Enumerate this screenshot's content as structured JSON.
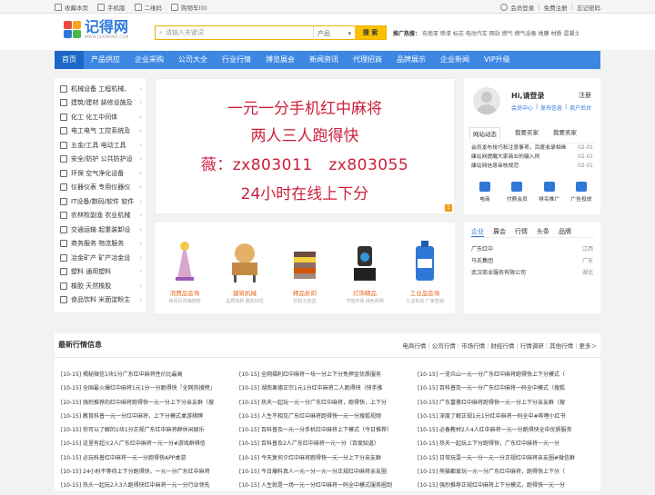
{
  "topbar": {
    "left": [
      "收藏本页",
      "手机版",
      "二维码",
      "购物车(0)"
    ],
    "right": [
      "会员登录",
      "免费注册",
      "忘记密码"
    ]
  },
  "logo": {
    "name": "记得网",
    "sub": "WWW.JIDEWANG.COM"
  },
  "search": {
    "placeholder": "请输入关键词",
    "category": "产品",
    "button": "搜 索"
  },
  "hot": {
    "label": "推广热搜：",
    "items": [
      "东南亚",
      "喷漆",
      "标志",
      "电动汽车",
      "网站",
      "燃气",
      "燃气设备",
      "地膜",
      "材质",
      "混凝土"
    ]
  },
  "nav": [
    "首页",
    "产品供应",
    "企业采购",
    "公司大全",
    "行业行情",
    "博览展会",
    "新闻资讯",
    "代理招商",
    "品牌展示",
    "企业新闻",
    "VIP升级"
  ],
  "categories": [
    "机械设备 工程机械、",
    "建筑/建材 装修设施及",
    "化工 化工中间体",
    "电工电气 工控系统及",
    "五金/工具 电动工具",
    "安全/防护 公共防护设",
    "环保 空气净化设备",
    "仪器仪表 专用仪器仪",
    "IT设备/数码/软件 软件",
    "农林牧副渔 农业机械",
    "交通运输 起重装卸设",
    "商务服务 物流服务",
    "冶金矿产 矿产冶金设",
    "塑料 通用塑料",
    "橡胶 天然橡胶",
    "食品饮料 米面淀粉主"
  ],
  "banner": {
    "line1": "一元一分手机红中麻将",
    "line2": "两人三人跑得快",
    "line3a": "薇：zx803011",
    "line3b": "zx803055",
    "line4": "24小时在线上下分",
    "corner": "1"
  },
  "products": [
    {
      "title": "消费品会场",
      "sub": "休闲百货嗨购物"
    },
    {
      "title": "建筑机械",
      "sub": "品质高新 服务好优"
    },
    {
      "title": "精品折扣",
      "sub": "折扣大放送"
    },
    {
      "title": "灯饰精品",
      "sub": "节能环保 绿色照明"
    },
    {
      "title": "工业品会场",
      "sub": "工业制造 厂家直销"
    }
  ],
  "user": {
    "greeting": "Hi,请登录",
    "register": "注册",
    "links": [
      "会员中心",
      "发布信息",
      "商户后台"
    ],
    "tabs": [
      "网站动态",
      "我要买家",
      "我要卖家"
    ],
    "news": [
      {
        "t": "会员发布技巧和注意事项，百度收录相继",
        "d": "02-01"
      },
      {
        "t": "康站网提醒大家商业的骗入例",
        "d": "02-01"
      },
      {
        "t": "康站网信息审核规范",
        "d": "02-01"
      }
    ],
    "services": [
      "电商",
      "付费会员",
      "排名推广",
      "广告投放"
    ]
  },
  "companies": {
    "tabs": [
      "企业",
      "展会",
      "行情",
      "头条",
      "品牌"
    ],
    "rows": [
      {
        "n": "广东红中",
        "p": "江西"
      },
      {
        "n": "马氏集团",
        "p": "广东"
      },
      {
        "n": "武汉商业服务有限公司",
        "p": "湖北"
      }
    ]
  },
  "market": {
    "title": "最新行情信息",
    "links": [
      "电商行情",
      "公司行情",
      "市场行情",
      "财经行情",
      "行情调研",
      "其他行情",
      "更多＞"
    ],
    "col1": [
      "[10-15]  揭秘微信1块1分广东红中麻将性价比最高",
      "[10-15]  全国最火爆红中麻将1元1分一分跑得快『全网热搜榜』",
      "[10-15]  强烈推荐的红中麻将跑得快一元一分上下分亲友群（搜",
      "[10-15]  教育科普一元一分红中麻将，上下分模式桌游棋牌",
      "[10-15]  你可以了解的1块1分正规广东红中麻将群休闲娱乐",
      "[10-15]  这里有超火2人广东红中麻将一元一分#游戏群棋信",
      "[10-15]  必玩科普红中麻将一元一分跑得快APP桌游",
      "[10-15]  24小时不等待上下分跑得快，一元一分广东红中麻将",
      "[10-15]  热头一起玩2人3人跑得快红中麻将一元一分行业领先"
    ],
    "col2": [
      "[10-15]  全网福利红中麻将一块一分上下分免押金优质服务",
      "[10-15]  湖南果德正宗1元1分红中麻将二人跑得快（快手推",
      "[10-15]  热天一起玩一元一分广东红中麻将，跑得快，上下分",
      "[10-15]  人生不相见广东红中麻将跑得快一元一分搜狐视频",
      "[10-15]  百科普及一元一分手机红中麻将上下模式（今日推荐）",
      "[10-15]  百科普及2人广东红中麻将一元一分（百度知道）",
      "[10-15]  今天复何夕红中麻将跑得快一元一分上下分亲友群",
      "[10-15]  今日爆料真人一元一分一元一分正规红中麻将亲友圈",
      "[10-15]  人生就是一场一元一分红中麻将一码全中模式服务圈到"
    ],
    "col3": [
      "[10-15]  一览众山一元一分广东红中麻将跑得快上下分模式（",
      "[10-15]  百科普及一元一分广东红中麻将一码全中模式（搜狐",
      "[10-15]  广东富豪红中麻将跑得快一元一分上下分亲友群（搜",
      "[10-15]  深度了解正规1元1分红中麻将一码全中#哔哩小红书",
      "[10-15]  必备教材2人4人红中麻将一元一分跑得快全中优质服务",
      "[10-15]  热天一起玩上下分跑得快，广东红中麻将一元一分",
      "[10-15]  日常玩耍一元一分一元一分正规红中麻将亲友圈#微信群",
      "[10-15]  熊猫都爱玩一元一分广东红中麻将，跑得快上下分（",
      "[10-15]  强烈推荐正规红中麻将上下分模式，跑得快一元一分"
    ]
  }
}
